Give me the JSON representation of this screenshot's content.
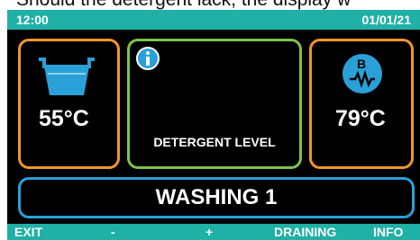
{
  "caption": "Should the detergent lack, the display w",
  "header": {
    "time": "12:00",
    "date": "01/01/21"
  },
  "wash_temp": {
    "value": "55°C",
    "icon": "washtub-icon"
  },
  "detergent": {
    "label": "DETERGENT LEVEL",
    "icon": "info-icon"
  },
  "boiler_temp": {
    "value": "79°C",
    "badge": "B",
    "icon": "boiler-heater-icon"
  },
  "status": "WASHING 1",
  "footer": {
    "exit": "EXIT",
    "minus": "-",
    "plus": "+",
    "draining": "DRAINING",
    "info": "INFO"
  },
  "colors": {
    "bar": "#1fb0a6",
    "orange_border": "#f0962e",
    "green_border": "#7ec24a",
    "blue_border": "#2aa0d8",
    "icon_blue": "#2aa0d8"
  }
}
